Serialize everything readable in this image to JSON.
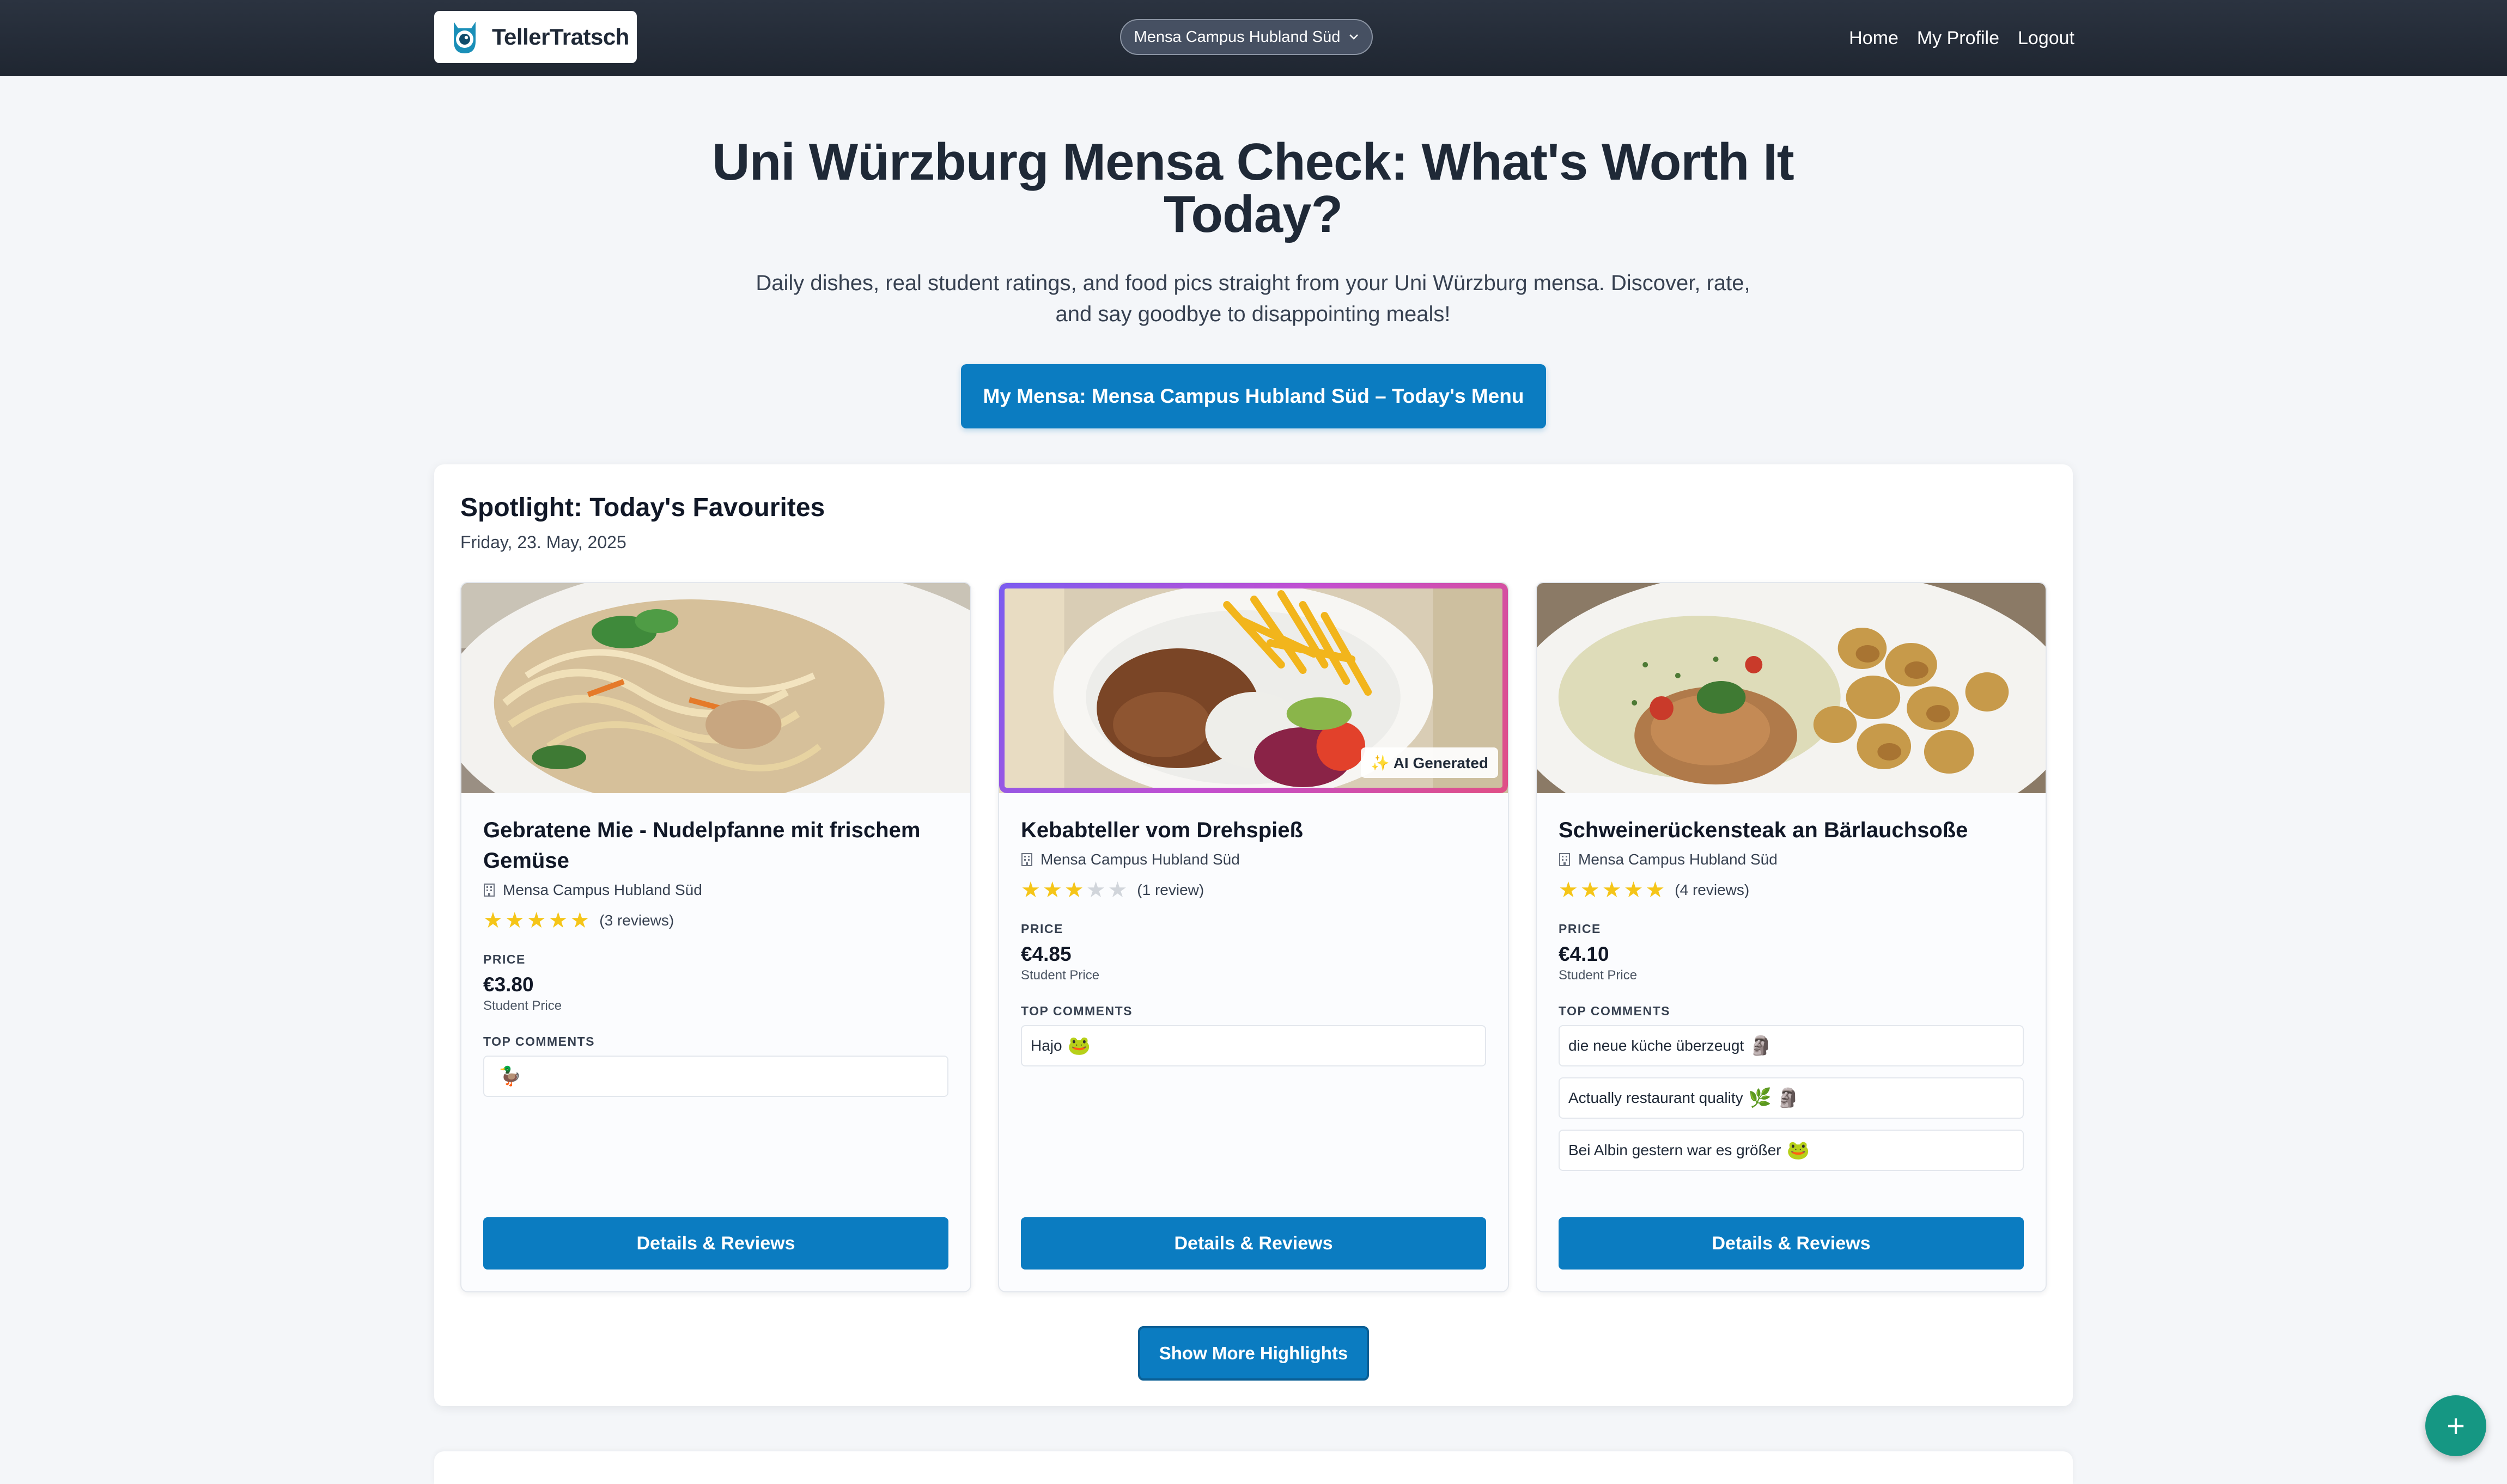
{
  "navbar": {
    "brand": "TellerTratsch",
    "mensa_select": "Mensa Campus Hubland Süd",
    "links": [
      "Home",
      "My Profile",
      "Logout"
    ]
  },
  "hero": {
    "title": "Uni Würzburg Mensa Check: What's Worth It Today?",
    "subtitle": "Daily dishes, real student ratings, and food pics straight from your Uni Würzburg mensa. Discover, rate, and say goodbye to disappointing meals!",
    "cta": "My Mensa: Mensa Campus Hubland Süd – Today's Menu"
  },
  "spotlight": {
    "title": "Spotlight: Today's Favourites",
    "date": "Friday, 23. May, 2025",
    "price_label": "PRICE",
    "price_sub": "Student Price",
    "comments_label": "TOP COMMENTS",
    "details_label": "Details & Reviews",
    "ai_badge": "✨ AI Generated",
    "more_button": "Show More Highlights",
    "cards": [
      {
        "name": "Gebratene Mie - Nudelpfanne mit frischem Gemüse",
        "location": "Mensa Campus Hubland Süd",
        "rating": 5,
        "reviews": "(3 reviews)",
        "price": "€3.80",
        "comments": [
          {
            "text": "",
            "emoji": "🦆"
          }
        ]
      },
      {
        "name": "Kebabteller vom Drehspieß",
        "location": "Mensa Campus Hubland Süd",
        "rating": 3,
        "reviews": "(1 review)",
        "price": "€4.85",
        "comments": [
          {
            "text": "Hajo",
            "emoji": "🐸"
          }
        ]
      },
      {
        "name": "Schweinerückensteak an Bärlauchsoße",
        "location": "Mensa Campus Hubland Süd",
        "rating": 5,
        "reviews": "(4 reviews)",
        "price": "€4.10",
        "comments": [
          {
            "text": "die neue küche überzeugt",
            "emoji": "🗿"
          },
          {
            "text": "Actually restaurant quality",
            "emoji": "🌿 🗿"
          },
          {
            "text": "Bei Albin gestern war es größer",
            "emoji": "🐸"
          }
        ]
      }
    ]
  },
  "fab": "+"
}
